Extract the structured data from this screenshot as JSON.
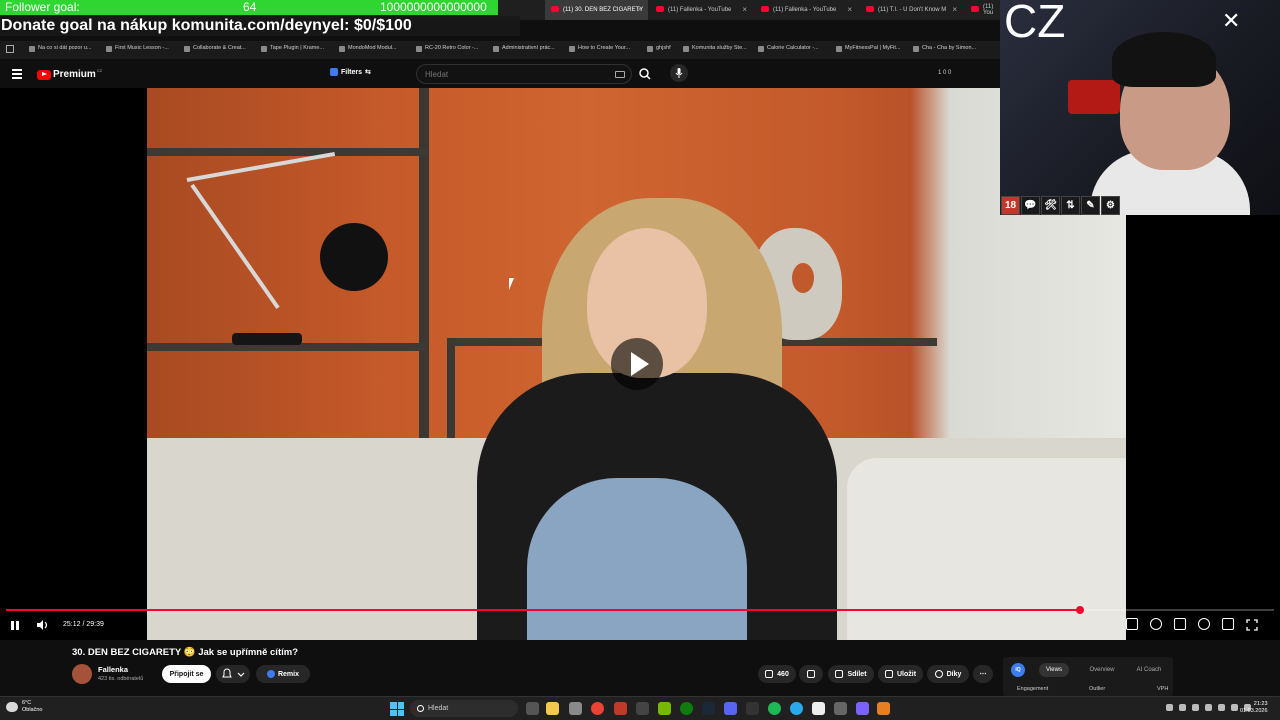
{
  "overlay": {
    "follower_label": "Follower goal:",
    "follower_count": "64",
    "follower_target": "1000000000000000",
    "donate_text": "Donate goal na nákup komunita.com/deynyel: $0/$100",
    "webcam_text": "CZ",
    "badges": [
      "18",
      "💬",
      "🛠",
      "⇅",
      "✎",
      "⚙"
    ]
  },
  "browser": {
    "tabs": [
      {
        "title": "(11) 30. DEN BEZ CIGARETY",
        "active": true
      },
      {
        "title": "(11) Fallenka - YouTube",
        "active": false
      },
      {
        "title": "(11) Fallenka - YouTube",
        "active": false
      },
      {
        "title": "(11) T.I. - U Don't Know M",
        "active": false
      },
      {
        "title": "(11) You",
        "active": false
      }
    ],
    "bookmarks": [
      "Na co si dát pozor u...",
      "First Music Lesson -...",
      "Collaborate & Creat...",
      "Tape Plugin | Krame...",
      "MondoMod Modul...",
      "RC-20 Retro Color -...",
      "Administrativní prác...",
      "How to Create Your...",
      "ghjshf",
      "Komunita služby Ste...",
      "Calorie Calculator -...",
      "MyFitnessPal | MyFit...",
      "Cha - Cha by Simon..."
    ]
  },
  "youtube": {
    "logo_text": "Premium",
    "country_code": "CZ",
    "filters_label": "Filters",
    "search_placeholder": "Hledat",
    "counters": "1  0  0",
    "player": {
      "time": "25:12 / 29:39",
      "progress_fraction": 0.847
    },
    "video": {
      "title": "30. DEN BEZ CIGARETY 😳 Jak se upřímně cítím?",
      "channel": "Fallenka",
      "subscribers": "423 tis. odběratelů",
      "subscribe_label": "Připojit se",
      "remix_label": "Remix",
      "likes": "460",
      "share_label": "Sdílet",
      "save_label": "Uložit",
      "thanks_label": "Díky"
    },
    "widget": {
      "icon_label": "IQ",
      "tabs": [
        "Views",
        "Overview",
        "AI Coach"
      ],
      "subheads": [
        "Engagement",
        "Outlier",
        "VPH"
      ]
    }
  },
  "taskbar": {
    "weather_temp": "6°C",
    "weather_desc": "Oblačno",
    "search_label": "Hledat",
    "time": "21:23",
    "date": "01.03.2026"
  },
  "colors": {
    "accent_red": "#ff0033",
    "goal_green": "#2fd631",
    "yt_blue": "#3c7bf0"
  }
}
